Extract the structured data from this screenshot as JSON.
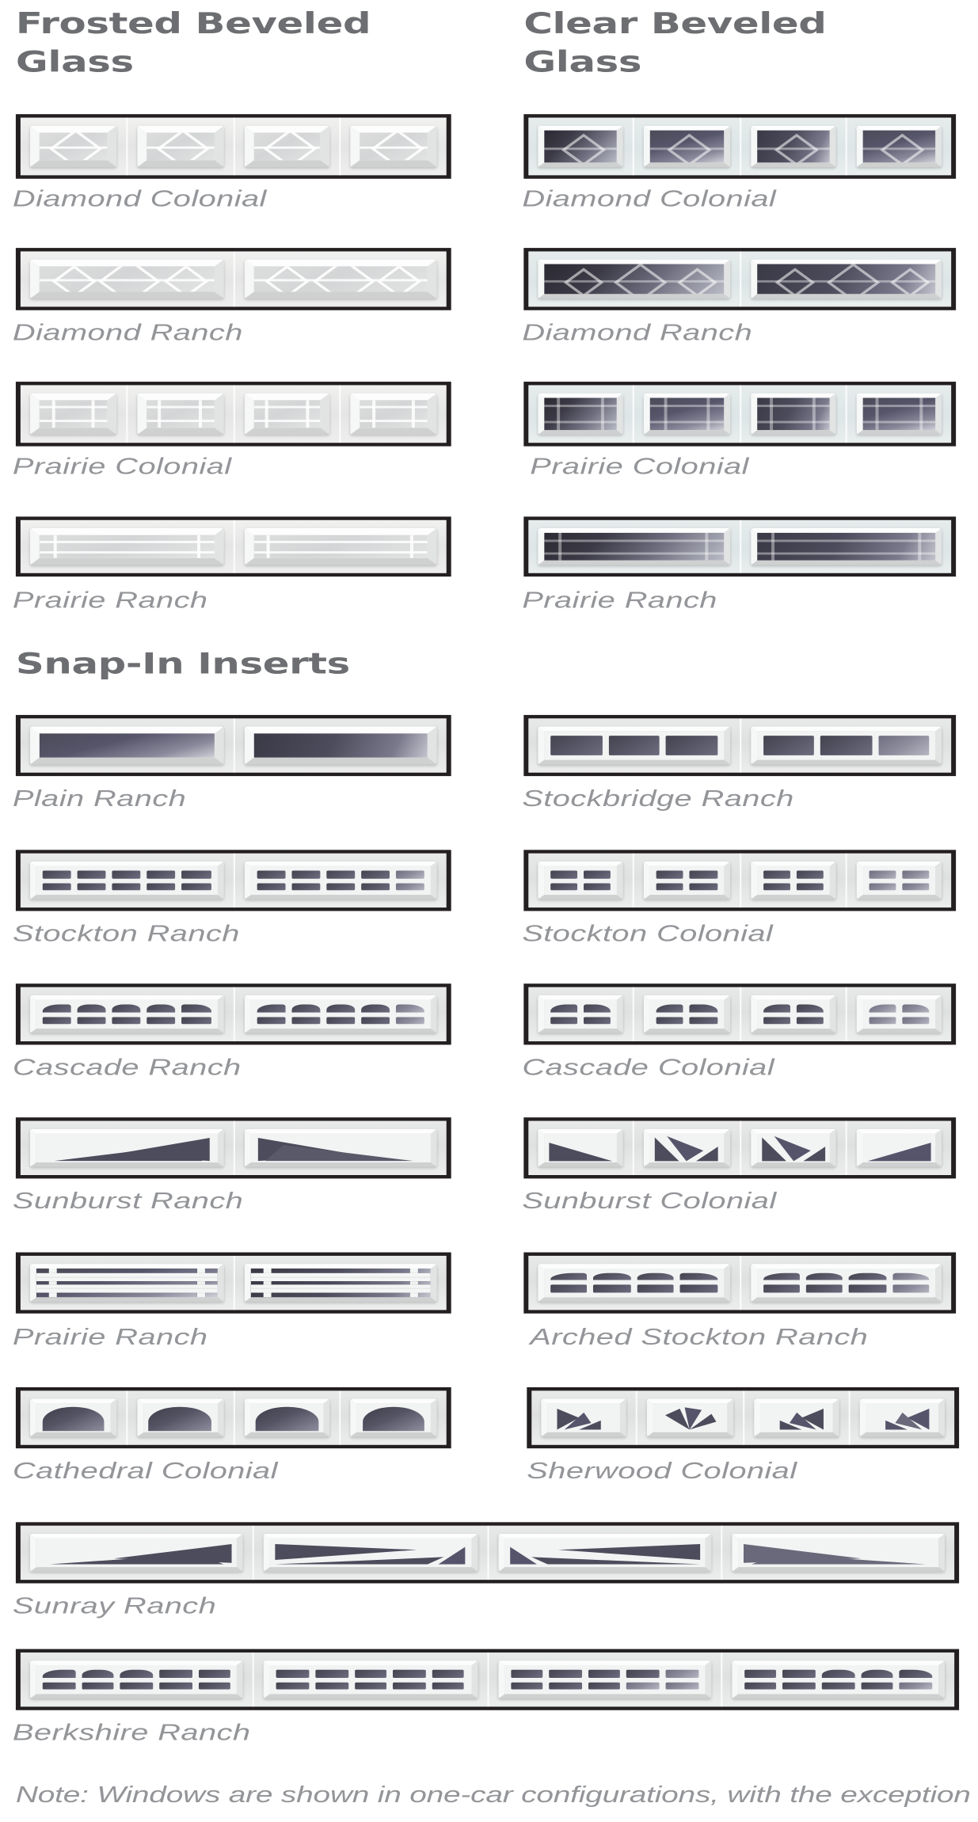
{
  "headings": {
    "frosted_beveled_glass": "Frosted Beveled\nGlass",
    "clear_beveled_glass": "Clear Beveled\nGlass",
    "snap_in_inserts": "Snap-In Inserts"
  },
  "colors": {
    "heading": "#6d6e71",
    "caption": "#939598",
    "door_border": "#231f20",
    "frosted_glass": "#d8d9da",
    "clear_glass": "#3b3a46",
    "panel_white": "#f2f3f3"
  },
  "beveled_glass": {
    "left_column_title": "Frosted Beveled Glass",
    "right_column_title": "Clear Beveled Glass",
    "rows": [
      {
        "left": "Diamond Colonial",
        "right": "Diamond Colonial"
      },
      {
        "left": "Diamond Ranch",
        "right": "Diamond Ranch"
      },
      {
        "left": "Prairie Colonial",
        "right": "Prairie Colonial"
      },
      {
        "left": "Prairie Ranch",
        "right": "Prairie Ranch"
      }
    ]
  },
  "snap_in_inserts": {
    "title": "Snap-In Inserts",
    "rows": [
      {
        "left": "Plain Ranch",
        "right": "Stockbridge Ranch"
      },
      {
        "left": "Stockton Ranch",
        "right": "Stockton Colonial"
      },
      {
        "left": "Cascade Ranch",
        "right": "Cascade Colonial"
      },
      {
        "left": "Sunburst Ranch",
        "right": "Sunburst Colonial"
      },
      {
        "left": "Prairie Ranch",
        "right": "Arched Stockton Ranch"
      },
      {
        "left": "Cathedral Colonial",
        "right": "Sherwood Colonial"
      }
    ],
    "full_width_rows": [
      {
        "label": "Sunray Ranch"
      },
      {
        "label": "Berkshire Ranch"
      }
    ]
  },
  "footnote": "Note: Windows are shown in one-car configurations, with the exception of Sunray Ranch and Berkshire Ranch."
}
